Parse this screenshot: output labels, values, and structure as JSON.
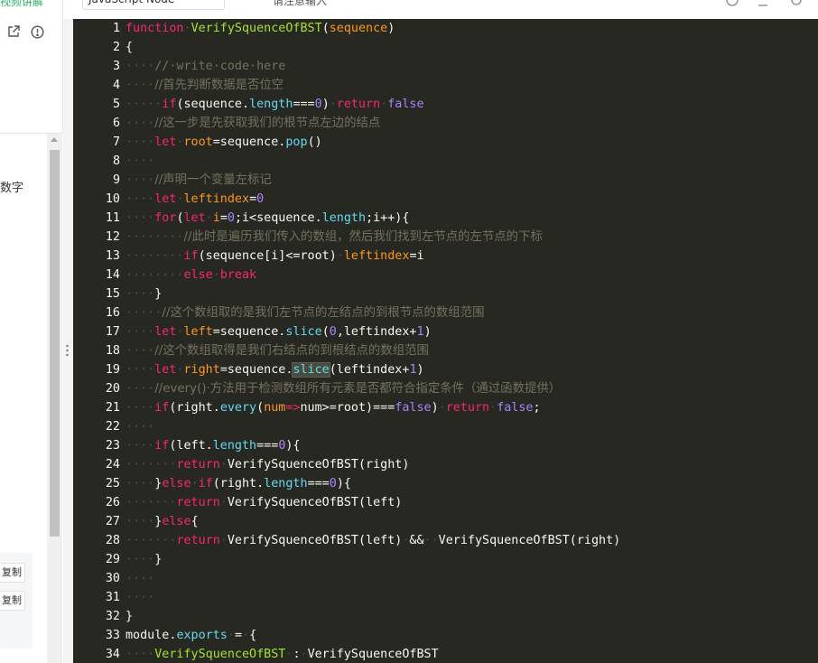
{
  "left_panel": {
    "top_link": "视频讲解",
    "text_fragment": "数字",
    "copy_buttons": [
      "复制",
      "复制"
    ]
  },
  "icons": {
    "open_external": "external-link-icon",
    "info": "info-icon",
    "drag_handle": "drag-handle-icon"
  },
  "toolbar": {
    "language": "JavaScript Node",
    "hint_text": "请注意输入"
  },
  "colors": {
    "editor_bg": "#272822",
    "keyword": "#f92672",
    "function": "#a6e22e",
    "param": "#fd971f",
    "comment": "#75715e",
    "number": "#ae81ff",
    "builtin": "#66d9ef",
    "brand_green": "#2bb56a"
  },
  "editor": {
    "lines": [
      [
        [
          "kw",
          "function"
        ],
        [
          "ind",
          "·"
        ],
        [
          "fn",
          "VerifySquenceOfBST"
        ],
        [
          "t",
          "("
        ],
        [
          "prm",
          "sequence"
        ],
        [
          "t",
          ")"
        ]
      ],
      [
        [
          "t",
          "{"
        ]
      ],
      [
        [
          "ind",
          "····"
        ],
        [
          "cm",
          "//·write·code·here"
        ]
      ],
      [
        [
          "ind",
          "····"
        ],
        [
          "cm",
          "//首先判断数据是否位空"
        ]
      ],
      [
        [
          "ind",
          "·····"
        ],
        [
          "kw",
          "if"
        ],
        [
          "t",
          "(sequence."
        ],
        [
          "bi",
          "length"
        ],
        [
          "t",
          "==="
        ],
        [
          "num",
          "0"
        ],
        [
          "t",
          ")"
        ],
        [
          "ind",
          "·"
        ],
        [
          "kw",
          "return"
        ],
        [
          "ind",
          "·"
        ],
        [
          "num",
          "false"
        ]
      ],
      [
        [
          "ind",
          "····"
        ],
        [
          "cm",
          "//这一步是先获取我们的根节点左边的结点"
        ]
      ],
      [
        [
          "ind",
          "····"
        ],
        [
          "kw",
          "let"
        ],
        [
          "ind",
          "·"
        ],
        [
          "prm",
          "root"
        ],
        [
          "t",
          "=sequence."
        ],
        [
          "bi",
          "pop"
        ],
        [
          "t",
          "()"
        ]
      ],
      [
        [
          "ind",
          "····"
        ]
      ],
      [
        [
          "ind",
          "····"
        ],
        [
          "cm",
          "//声明一个变量左标记"
        ]
      ],
      [
        [
          "ind",
          "····"
        ],
        [
          "kw",
          "let"
        ],
        [
          "ind",
          "·"
        ],
        [
          "prm",
          "leftindex"
        ],
        [
          "t",
          "="
        ],
        [
          "num",
          "0"
        ]
      ],
      [
        [
          "ind",
          "····"
        ],
        [
          "kw",
          "for"
        ],
        [
          "t",
          "("
        ],
        [
          "kw",
          "let"
        ],
        [
          "ind",
          "·"
        ],
        [
          "prm",
          "i"
        ],
        [
          "t",
          "="
        ],
        [
          "num",
          "0"
        ],
        [
          "t",
          ";i<sequence."
        ],
        [
          "bi",
          "length"
        ],
        [
          "t",
          ";i++){"
        ]
      ],
      [
        [
          "ind",
          "········"
        ],
        [
          "cm",
          "//此时是遍历我们传入的数组，然后我们找到左节点的左节点的下标"
        ]
      ],
      [
        [
          "ind",
          "········"
        ],
        [
          "kw",
          "if"
        ],
        [
          "t",
          "(sequence[i]<=root)"
        ],
        [
          "ind",
          "·"
        ],
        [
          "prm",
          "leftindex"
        ],
        [
          "t",
          "=i"
        ]
      ],
      [
        [
          "ind",
          "········"
        ],
        [
          "kw",
          "else"
        ],
        [
          "ind",
          "·"
        ],
        [
          "kw",
          "break"
        ]
      ],
      [
        [
          "ind",
          "····"
        ],
        [
          "t",
          "}"
        ]
      ],
      [
        [
          "ind",
          "·····"
        ],
        [
          "cm",
          "//这个数组取的是我们左节点的左结点的到根节点的数组范围"
        ]
      ],
      [
        [
          "ind",
          "····"
        ],
        [
          "kw",
          "let"
        ],
        [
          "ind",
          "·"
        ],
        [
          "prm",
          "left"
        ],
        [
          "t",
          "=sequence."
        ],
        [
          "bi",
          "slice"
        ],
        [
          "t",
          "("
        ],
        [
          "num",
          "0"
        ],
        [
          "t",
          ",leftindex+"
        ],
        [
          "num",
          "1"
        ],
        [
          "t",
          ")"
        ]
      ],
      [
        [
          "ind",
          "····"
        ],
        [
          "cm",
          "//这个数组取得是我们右结点的到根结点的数组范围"
        ]
      ],
      [
        [
          "ind",
          "····"
        ],
        [
          "kw",
          "let"
        ],
        [
          "ind",
          "·"
        ],
        [
          "prm",
          "right"
        ],
        [
          "t",
          "=sequence."
        ],
        [
          "bihl",
          "slice"
        ],
        [
          "t",
          "(leftindex+"
        ],
        [
          "num",
          "1"
        ],
        [
          "t",
          ")"
        ]
      ],
      [
        [
          "ind",
          "····"
        ],
        [
          "cm",
          "//every()·方法用于检测数组所有元素是否都符合指定条件（通过函数提供）"
        ]
      ],
      [
        [
          "ind",
          "····"
        ],
        [
          "kw",
          "if"
        ],
        [
          "t",
          "(right."
        ],
        [
          "bi",
          "every"
        ],
        [
          "t",
          "("
        ],
        [
          "prm",
          "num"
        ],
        [
          "kw",
          "=>"
        ],
        [
          "t",
          "num>=root)==="
        ],
        [
          "num",
          "false"
        ],
        [
          "t",
          ")"
        ],
        [
          "ind",
          "·"
        ],
        [
          "kw",
          "return"
        ],
        [
          "ind",
          "·"
        ],
        [
          "num",
          "false"
        ],
        [
          "t",
          ";"
        ]
      ],
      [
        [
          "ind",
          "····"
        ]
      ],
      [
        [
          "ind",
          "····"
        ],
        [
          "kw",
          "if"
        ],
        [
          "t",
          "(left."
        ],
        [
          "bi",
          "length"
        ],
        [
          "t",
          "==="
        ],
        [
          "num",
          "0"
        ],
        [
          "t",
          "){"
        ]
      ],
      [
        [
          "ind",
          "·······"
        ],
        [
          "kw",
          "return"
        ],
        [
          "ind",
          "·"
        ],
        [
          "t",
          "VerifySquenceOfBST(right)"
        ]
      ],
      [
        [
          "ind",
          "····"
        ],
        [
          "t",
          "}"
        ],
        [
          "kw",
          "else"
        ],
        [
          "ind",
          "·"
        ],
        [
          "kw",
          "if"
        ],
        [
          "t",
          "(right."
        ],
        [
          "bi",
          "length"
        ],
        [
          "t",
          "==="
        ],
        [
          "num",
          "0"
        ],
        [
          "t",
          "){"
        ]
      ],
      [
        [
          "ind",
          "·······"
        ],
        [
          "kw",
          "return"
        ],
        [
          "ind",
          "·"
        ],
        [
          "t",
          "VerifySquenceOfBST(left)"
        ]
      ],
      [
        [
          "ind",
          "····"
        ],
        [
          "t",
          "}"
        ],
        [
          "kw",
          "else"
        ],
        [
          "t",
          "{"
        ]
      ],
      [
        [
          "ind",
          "·······"
        ],
        [
          "kw",
          "return"
        ],
        [
          "ind",
          "·"
        ],
        [
          "t",
          "VerifySquenceOfBST(left)"
        ],
        [
          "ind",
          "·"
        ],
        [
          "t",
          "&&"
        ],
        [
          "ind",
          "··"
        ],
        [
          "t",
          "VerifySquenceOfBST(right)"
        ]
      ],
      [
        [
          "ind",
          "····"
        ],
        [
          "t",
          "}"
        ]
      ],
      [
        [
          "ind",
          "····"
        ]
      ],
      [
        [
          "ind",
          "····"
        ]
      ],
      [
        [
          "t",
          "}"
        ]
      ],
      [
        [
          "t",
          "module."
        ],
        [
          "bi",
          "exports"
        ],
        [
          "ind",
          "·"
        ],
        [
          "t",
          "="
        ],
        [
          "ind",
          "·"
        ],
        [
          "t",
          "{"
        ]
      ],
      [
        [
          "ind",
          "····"
        ],
        [
          "fn",
          "VerifySquenceOfBST"
        ],
        [
          "ind",
          "·"
        ],
        [
          "t",
          ":"
        ],
        [
          "ind",
          "·"
        ],
        [
          "t",
          "VerifySquenceOfBST"
        ]
      ]
    ]
  }
}
